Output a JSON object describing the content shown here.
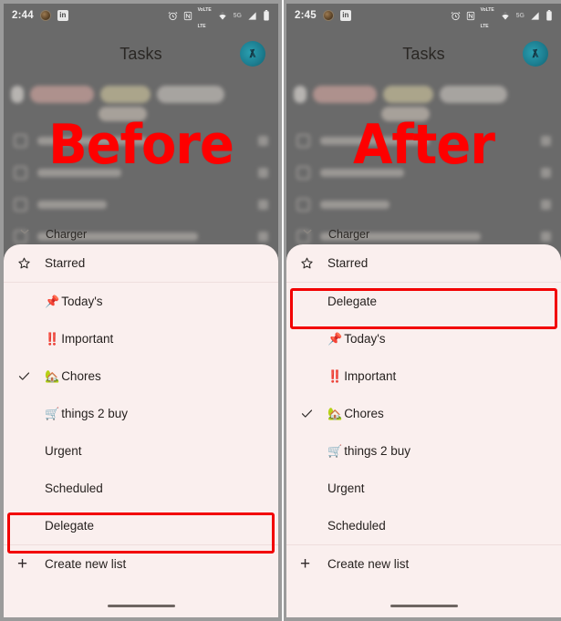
{
  "panels": [
    {
      "id": "before",
      "overlay_word": "Before",
      "status": {
        "time": "2:44",
        "linkedin": "in",
        "icons": [
          "alarm-icon",
          "nfc-icon",
          "volte-icon",
          "wifi-icon",
          "5g-icon",
          "signal-icon",
          "battery-icon"
        ],
        "volte_top": "VoLTE",
        "volte_bottom": "LTE",
        "network": "5G"
      },
      "appbar": {
        "title": "Tasks",
        "avatar": "account-avatar"
      },
      "background": {
        "visible_task_label": "Charger"
      },
      "menu": {
        "items": [
          {
            "label": "Starred",
            "lead": "star",
            "emoji": "",
            "highlight": false
          },
          {
            "label": "Today's",
            "lead": "none",
            "emoji": "📌",
            "highlight": false
          },
          {
            "label": "Important",
            "lead": "none",
            "emoji": "‼️",
            "highlight": false
          },
          {
            "label": "Chores",
            "lead": "check",
            "emoji": "🏡",
            "highlight": false
          },
          {
            "label": "things 2 buy",
            "lead": "none",
            "emoji": "🛒",
            "highlight": false
          },
          {
            "label": "Urgent",
            "lead": "none",
            "emoji": "",
            "highlight": false
          },
          {
            "label": "Scheduled",
            "lead": "none",
            "emoji": "",
            "highlight": false
          },
          {
            "label": "Delegate",
            "lead": "none",
            "emoji": "",
            "highlight": true
          }
        ],
        "create_new_list": "Create new list"
      }
    },
    {
      "id": "after",
      "overlay_word": "After",
      "status": {
        "time": "2:45",
        "linkedin": "in",
        "icons": [
          "alarm-icon",
          "nfc-icon",
          "volte-icon",
          "wifi-icon",
          "5g-icon",
          "signal-icon",
          "battery-icon"
        ],
        "volte_top": "VoLTE",
        "volte_bottom": "LTE",
        "network": "5G"
      },
      "appbar": {
        "title": "Tasks",
        "avatar": "account-avatar"
      },
      "background": {
        "visible_task_label": "Charger"
      },
      "menu": {
        "items": [
          {
            "label": "Starred",
            "lead": "star",
            "emoji": "",
            "highlight": false
          },
          {
            "label": "Delegate",
            "lead": "none",
            "emoji": "",
            "highlight": true
          },
          {
            "label": "Today's",
            "lead": "none",
            "emoji": "📌",
            "highlight": false
          },
          {
            "label": "Important",
            "lead": "none",
            "emoji": "‼️",
            "highlight": false
          },
          {
            "label": "Chores",
            "lead": "check",
            "emoji": "🏡",
            "highlight": false
          },
          {
            "label": "things 2 buy",
            "lead": "none",
            "emoji": "🛒",
            "highlight": false
          },
          {
            "label": "Urgent",
            "lead": "none",
            "emoji": "",
            "highlight": false
          },
          {
            "label": "Scheduled",
            "lead": "none",
            "emoji": "",
            "highlight": false
          }
        ],
        "create_new_list": "Create new list"
      }
    }
  ],
  "colors": {
    "sheet_bg": "#faefee",
    "highlight": "#f20000",
    "overlay_word": "#fe0000",
    "scrim": "#6a6a6a",
    "avatar_teal": "#1d7f92"
  }
}
